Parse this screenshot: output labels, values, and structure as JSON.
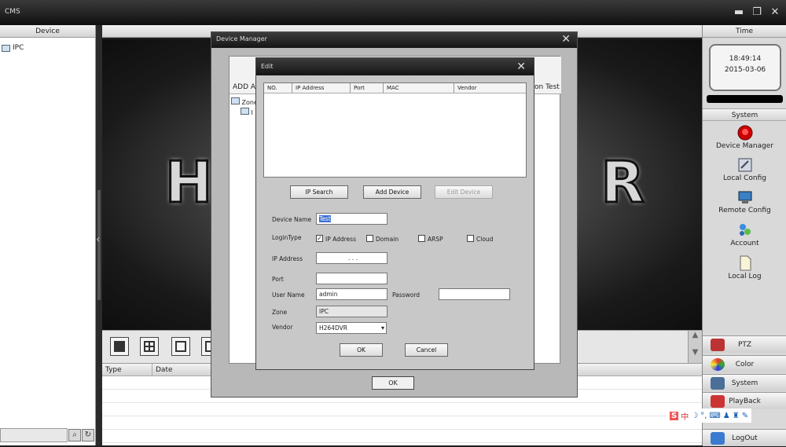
{
  "window": {
    "title": "CMS"
  },
  "left_panel": {
    "header": "Device",
    "tree_root": "IPC"
  },
  "right_panel": {
    "header": "Time",
    "clock_time": "18:49:14",
    "clock_date": "2015-03-06",
    "system_header": "System",
    "system_items": [
      {
        "label": "Device Manager",
        "icon": "power-button-icon"
      },
      {
        "label": "Local Config",
        "icon": "local-config-icon"
      },
      {
        "label": "Remote Config",
        "icon": "remote-config-icon"
      },
      {
        "label": "Account",
        "icon": "account-icon"
      },
      {
        "label": "Local Log",
        "icon": "document-icon"
      }
    ],
    "nav_buttons": [
      {
        "label": "PTZ"
      },
      {
        "label": "Color"
      },
      {
        "label": "System"
      },
      {
        "label": "PlayBack"
      },
      {
        "label": "LogOut"
      }
    ]
  },
  "log_table": {
    "columns": [
      "Type",
      "Date"
    ]
  },
  "ime_bar": {
    "glyphs": "中"
  },
  "device_manager": {
    "title": "Device Manager",
    "toolbar_left": "ADD AR",
    "toolbar_right": "on Test",
    "tree_zone": "Zone",
    "tree_child": "I",
    "ok": "OK"
  },
  "edit_dialog": {
    "title": "Edit",
    "columns": [
      "NO.",
      "IP Address",
      "Port",
      "MAC",
      "Vendor"
    ],
    "btn_ip_search": "IP Search",
    "btn_add_device": "Add Device",
    "btn_edit_device": "Edit Device",
    "device_name_label": "Device Name",
    "device_name_value": "Test",
    "login_type_label": "LoginType",
    "login_options": [
      {
        "label": "IP Address",
        "checked": true
      },
      {
        "label": "Domain",
        "checked": false
      },
      {
        "label": "ARSP",
        "checked": false
      },
      {
        "label": "Cloud",
        "checked": false
      }
    ],
    "ip_address_label": "IP Address",
    "ip_address_value": ".   .   .",
    "port_label": "Port",
    "port_value": "",
    "user_name_label": "User Name",
    "user_name_value": "admin",
    "password_label": "Password",
    "password_value": "",
    "zone_label": "Zone",
    "zone_value": "IPC",
    "vendor_label": "Vendor",
    "vendor_value": "H264DVR",
    "ok": "OK",
    "cancel": "Cancel"
  }
}
